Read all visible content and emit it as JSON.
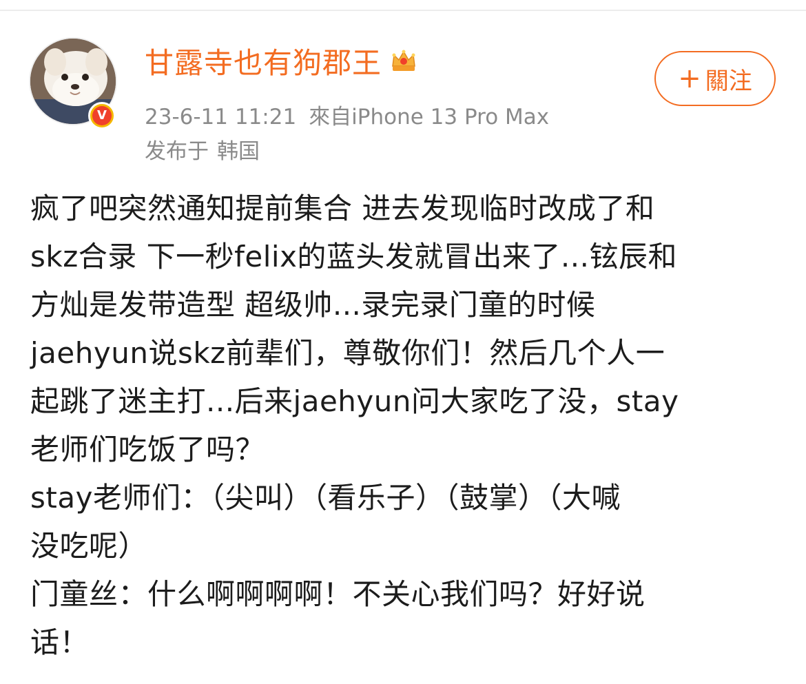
{
  "author": {
    "name": "甘露寺也有狗郡王",
    "verified_badge": "V",
    "timestamp": "23-6-11 11:21",
    "source": "來自iPhone 13 Pro Max",
    "location_label": "发布于",
    "location": "韩国",
    "avatar_icon": "pomeranian-dog-avatar",
    "member_icon": "crown-icon"
  },
  "follow_button": {
    "label": "關注",
    "icon": "+"
  },
  "post": {
    "lines": [
      "疯了吧突然通知提前集合 进去发现临时改成了和",
      "skz合录 下一秒felix的蓝头发就冒出来了...铉辰和",
      "方灿是发带造型 超级帅...录完录门童的时候",
      "jaehyun说skz前辈们，尊敬你们！然后几个人一",
      "起跳了迷主打...后来jaehyun问大家吃了没，stay",
      "老师们吃饭了吗？",
      "stay老师们：（尖叫）（看乐子）（鼓掌）（大喊",
      "没吃呢）",
      "门童丝：什么啊啊啊啊！不关心我们吗？好好说",
      "话！"
    ]
  },
  "colors": {
    "accent": "#f36c21",
    "meta": "#8a8a8a",
    "badge_yellow": "#f5b800",
    "badge_red": "#f0402a"
  }
}
